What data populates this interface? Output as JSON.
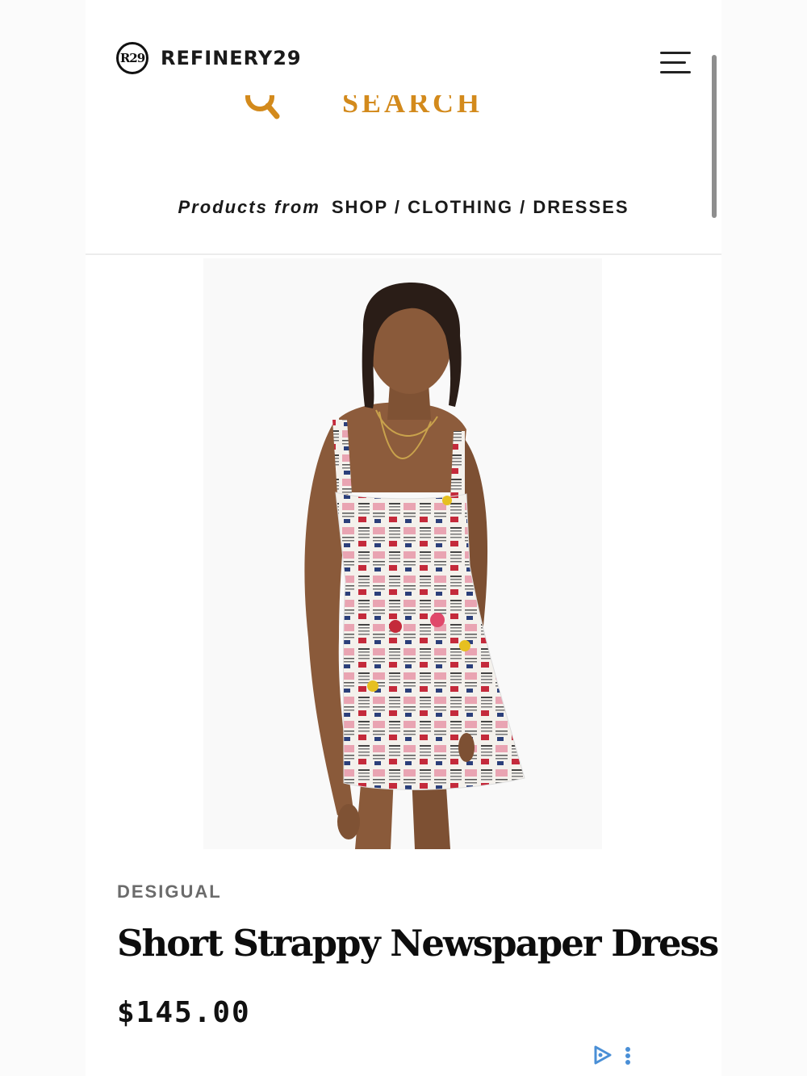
{
  "header": {
    "logo_badge": "R29",
    "logo_text": "REFINERY29",
    "menu_icon": "hamburger-menu-icon"
  },
  "search": {
    "label": "SEARCH",
    "icon": "search-icon",
    "accent_color": "#d38a1c"
  },
  "breadcrumb": {
    "prefix": "Products from",
    "path": "SHOP / CLOTHING / DRESSES"
  },
  "product": {
    "brand": "DESIGUAL",
    "name": "Short Strappy Newspaper Dress",
    "price": "$145.00",
    "image_alt": "Model wearing a short strappy newspaper-print dress"
  },
  "ad": {
    "play_icon": "adchoices-play-icon",
    "more_icon": "more-options-icon",
    "accent_color": "#4a8fd6"
  }
}
